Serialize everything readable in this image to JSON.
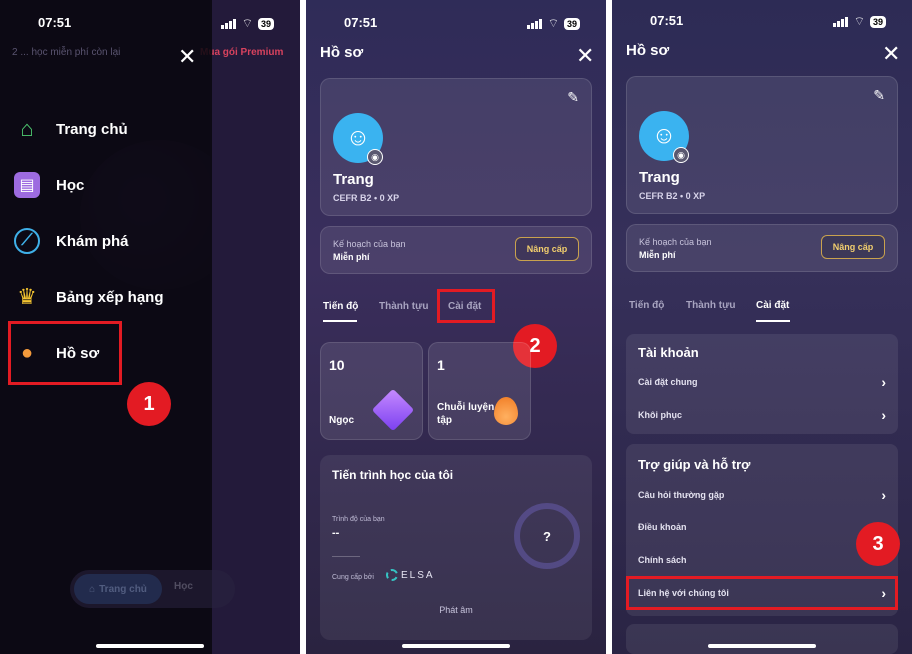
{
  "status": {
    "time": "07:51",
    "battery": "39"
  },
  "panel1": {
    "bg_top_text": "2 ... học miễn phí còn lại",
    "bg_premium": "Mua gói Premium",
    "menu": [
      {
        "label": "Trang chủ",
        "icon": "home-icon"
      },
      {
        "label": "Học",
        "icon": "book-icon"
      },
      {
        "label": "Khám phá",
        "icon": "compass-icon"
      },
      {
        "label": "Bảng xếp hạng",
        "icon": "trophy-icon"
      },
      {
        "label": "Hồ sơ",
        "icon": "user-icon"
      }
    ],
    "bottom_tab_home": "Trang chủ",
    "bottom_tab_learn": "Học",
    "badge": "1"
  },
  "profile": {
    "title": "Hồ sơ",
    "name": "Trang",
    "level": "CEFR B2 • 0 XP",
    "plan_label": "Kế hoạch của bạn",
    "plan_value": "Miễn phí",
    "upgrade": "Nâng cấp",
    "tabs": [
      "Tiến độ",
      "Thành tựu",
      "Cài đặt"
    ]
  },
  "panel2": {
    "badge": "2",
    "stats": [
      {
        "value": "10",
        "label": "Ngọc",
        "icon": "gem-icon"
      },
      {
        "value": "1",
        "label": "Chuỗi luyện tập",
        "icon": "flame-icon"
      }
    ],
    "progress_title": "Tiến trình học của tôi",
    "level_label": "Trình độ của bạn",
    "level_value": "--",
    "provider_label": "Cung cấp bởi",
    "provider": "ELSA",
    "ring_text": "?",
    "sound": "Phát âm"
  },
  "panel3": {
    "badge": "3",
    "account_title": "Tài khoản",
    "account_rows": [
      "Cài đặt chung",
      "Khôi phục"
    ],
    "help_title": "Trợ giúp và hỗ trợ",
    "help_rows": [
      "Câu hỏi thường gặp",
      "Điều khoản",
      "Chính sách",
      "Liên hệ với chúng tôi"
    ]
  },
  "colors": {
    "highlight": "#e31b23",
    "accent_gold": "#f2cf6e"
  }
}
